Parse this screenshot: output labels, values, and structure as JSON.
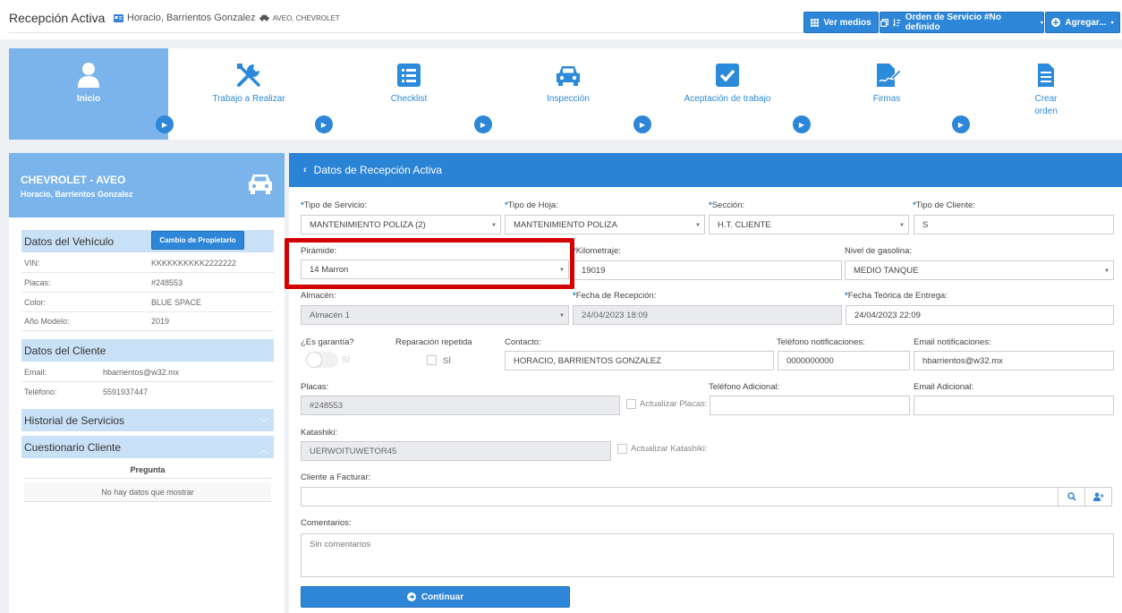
{
  "header": {
    "title": "Recepción Activa",
    "owner": "Horacio, Barrientos Gonzalez",
    "vehicle": "AVEO, CHEVROLET",
    "btn_ver_medios": "Ver medios",
    "btn_orden": "Orden de Servicio #No definido",
    "btn_agregar": "Agregar..."
  },
  "steps": [
    {
      "label": "Inicio"
    },
    {
      "label": "Trabajo a Realizar"
    },
    {
      "label": "Checklist"
    },
    {
      "label": "Inspección"
    },
    {
      "label": "Aceptación de trabajo"
    },
    {
      "label": "Firmas"
    },
    {
      "label": "Crear orden"
    }
  ],
  "vehicle_panel": {
    "title": "CHEVROLET - AVEO",
    "subtitle": "Horacio, Barrientos Gonzalez"
  },
  "datos_vehiculo": {
    "title": "Datos del Vehículo",
    "cambio_btn": "Cambio de Propietario",
    "rows": [
      {
        "k": "VIN:",
        "v": "KKKKKKKKKK2222222"
      },
      {
        "k": "Placas:",
        "v": "#248553"
      },
      {
        "k": "Color:",
        "v": "BLUE SPACE"
      },
      {
        "k": "Año Modelo:",
        "v": "2019"
      }
    ]
  },
  "datos_cliente": {
    "title": "Datos del Cliente",
    "rows": [
      {
        "k": "Email:",
        "v": "hbarrientos@w32.mx"
      },
      {
        "k": "Teléfono:",
        "v": "5591937447"
      }
    ]
  },
  "historial": "Historial de Servicios",
  "cuestionario": {
    "title": "Cuestionario Cliente",
    "col": "Pregunta",
    "empty": "No hay datos que mostrar"
  },
  "form": {
    "header": "Datos de Recepción Activa",
    "tipo_servicio": {
      "label": "Tipo de Servicio:",
      "value": "MANTENIMIENTO POLIZA (2)"
    },
    "tipo_hoja": {
      "label": "Tipo de Hoja:",
      "value": "MANTENIMIENTO POLIZA"
    },
    "seccion": {
      "label": "Sección:",
      "value": "H.T. CLIENTE"
    },
    "tipo_cliente": {
      "label": "Tipo de Cliente:",
      "value": "S"
    },
    "piramide": {
      "label": "Pirámide:",
      "value": "14 Marron"
    },
    "kilometraje": {
      "label": "Kilometraje:",
      "value": "19019"
    },
    "nivel_gasolina": {
      "label": "Nivel de gasolina:",
      "value": "MEDIO TANQUE"
    },
    "almacen": {
      "label": "Almacén:",
      "value": "Almacén 1"
    },
    "fecha_recepcion": {
      "label": "Fecha de Recepción:",
      "value": "24/04/2023 18:09"
    },
    "fecha_entrega": {
      "label": "Fecha Teórica de Entrega:",
      "value": "24/04/2023 22:09"
    },
    "garantia": {
      "label": "¿Es garantía?",
      "option": "SÍ"
    },
    "reparacion": {
      "label": "Reparación repetida",
      "option": "SÍ"
    },
    "contacto": {
      "label": "Contacto:",
      "value": "HORACIO, BARRIENTOS GONZALEZ"
    },
    "tel_notif": {
      "label": "Teléfono notificaciones:",
      "value": "0000000000"
    },
    "email_notif": {
      "label": "Email notificaciones:",
      "value": "hbarrientos@w32.mx"
    },
    "placas": {
      "label": "Placas:",
      "value": "#248553",
      "check": "Actualizar Placas:"
    },
    "tel_adicional": {
      "label": "Teléfono Adicional:",
      "value": ""
    },
    "email_adicional": {
      "label": "Email Adicional:",
      "value": ""
    },
    "katashiki": {
      "label": "Katashiki:",
      "value": "UERWOITUWETOR45",
      "check": "Actualizar Katashiki:"
    },
    "cliente_facturar": {
      "label": "Cliente a Facturar:",
      "value": ""
    },
    "comentarios": {
      "label": "Comentarios:",
      "value": "Sin comentarios"
    },
    "continuar": "Continuar"
  },
  "colors": {
    "primary": "#2d86d7",
    "step_active": "#7ab4eb",
    "section_bg": "#c9e1f7",
    "highlight": "#d40000"
  }
}
